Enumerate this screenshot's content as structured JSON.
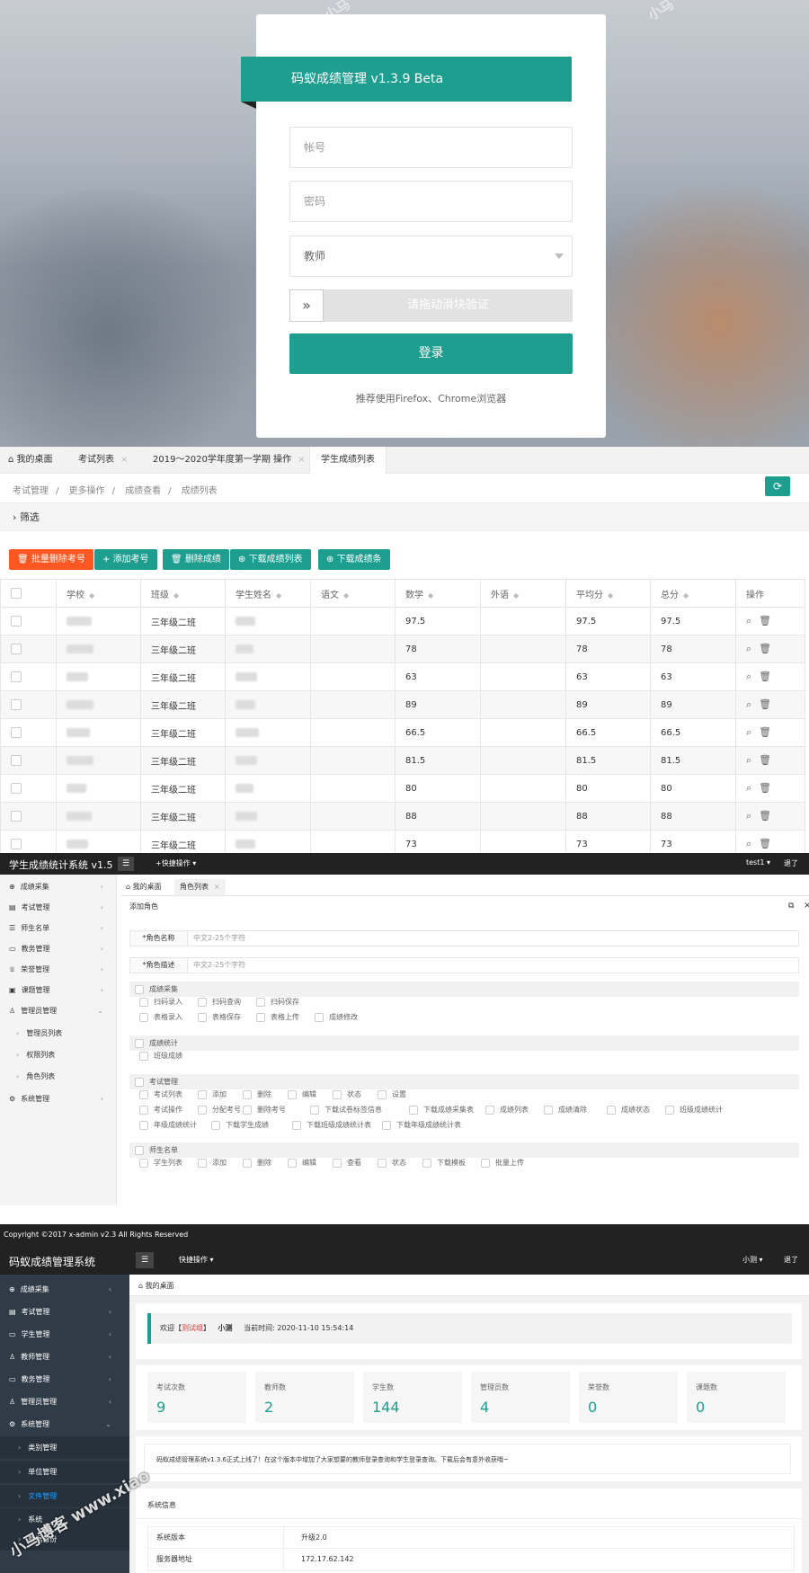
{
  "login": {
    "title": "码蚁成绩管理 v1.3.9 Beta",
    "account_placeholder": "帐号",
    "password_placeholder": "密码",
    "role_selected": "教师",
    "slider_text": "请拖动滑块验证",
    "submit_label": "登录",
    "hint": "推荐使用Firefox、Chrome浏览器",
    "brand_color": "#1e9e8f"
  },
  "score_list": {
    "tabs": [
      "我的桌面",
      "考试列表",
      "2019～2020学年度第一学期 操作",
      "学生成绩列表"
    ],
    "breadcrumb": [
      "考试管理",
      "更多操作",
      "成绩查看",
      "成绩列表"
    ],
    "filter_label": "筛选",
    "buttons": {
      "batch_delete": "批量删除考号",
      "add_exam_no": "添加考号",
      "delete_score": "删除成绩",
      "download_list": "下载成绩列表",
      "download_slip": "下载成绩条"
    },
    "columns": [
      "学校",
      "班级",
      "学生姓名",
      "语文",
      "数学",
      "外语",
      "平均分",
      "总分",
      "操作"
    ],
    "rows": [
      {
        "class": "三年级二班",
        "math": "97.5",
        "avg": "97.5",
        "total": "97.5"
      },
      {
        "class": "三年级二班",
        "math": "78",
        "avg": "78",
        "total": "78"
      },
      {
        "class": "三年级二班",
        "math": "63",
        "avg": "63",
        "total": "63"
      },
      {
        "class": "三年级二班",
        "math": "89",
        "avg": "89",
        "total": "89"
      },
      {
        "class": "三年级二班",
        "math": "66.5",
        "avg": "66.5",
        "total": "66.5"
      },
      {
        "class": "三年级二班",
        "math": "81.5",
        "avg": "81.5",
        "total": "81.5"
      },
      {
        "class": "三年级二班",
        "math": "80",
        "avg": "80",
        "total": "80"
      },
      {
        "class": "三年级二班",
        "math": "88",
        "avg": "88",
        "total": "88"
      },
      {
        "class": "三年级二班",
        "math": "73",
        "avg": "73",
        "total": "73"
      }
    ]
  },
  "role_admin": {
    "app_title": "学生成绩统计系统 v1.5",
    "quick_ops": "+快捷操作",
    "user": "test1",
    "logout": "退了",
    "sidebar": [
      "成绩采集",
      "考试管理",
      "师生名单",
      "教务管理",
      "荣誉管理",
      "课题管理",
      "管理员管理",
      "管理员列表",
      "权限列表",
      "角色列表",
      "系统管理"
    ],
    "tabs": [
      "我的桌面",
      "角色列表"
    ],
    "page_heading": "添加角色",
    "role_name_label": "*角色名称",
    "role_name_placeholder": "中文2-25个字符",
    "role_desc_label": "*角色描述",
    "role_desc_placeholder": "中文2-25个字符",
    "groups": [
      {
        "name": "成绩采集",
        "perms": [
          [
            "扫码录入",
            "扫码查询",
            "扫码保存"
          ],
          [
            "表格录入",
            "表格保存",
            "表格上传",
            "成绩修改"
          ]
        ]
      },
      {
        "name": "成绩统计",
        "perms": [
          [
            "班级成绩"
          ]
        ]
      },
      {
        "name": "考试管理",
        "perms": [
          [
            "考试列表",
            "添加",
            "删除",
            "编辑",
            "状态",
            "设置"
          ],
          [
            "考试操作",
            "分配考号",
            "删除考号",
            "下载试卷标签信息",
            "下载成绩采集表",
            "成绩列表",
            "成绩清除",
            "成绩状态",
            "班级成绩统计"
          ],
          [
            "年级成绩统计",
            "下载学生成绩",
            "下载班级成绩统计表",
            "下载年级成绩统计表"
          ]
        ]
      },
      {
        "name": "师生名单",
        "perms": [
          [
            "学生列表",
            "添加",
            "删除",
            "编辑",
            "查看",
            "状态",
            "下载模板",
            "批量上传"
          ]
        ]
      }
    ],
    "footer": "Copyright ©2017 x-admin v2.3 All Rights Reserved"
  },
  "dashboard": {
    "app_title": "码蚁成绩管理系统",
    "quick_ops": "快捷操作",
    "user": "小测",
    "logout": "退了",
    "sidebar": [
      "成绩采集",
      "考试管理",
      "学生管理",
      "教师管理",
      "教务管理",
      "管理员管理",
      "系统管理",
      "类别管理",
      "单位管理",
      "文件管理",
      "系统",
      "数据备份"
    ],
    "tab": "我的桌面",
    "welcome": {
      "prefix": "欢迎【",
      "role": "测试组",
      "suffix": "】",
      "name": "小测",
      "time_label": "当前时间:",
      "time": "2020-11-10 15:54:14"
    },
    "stats": [
      {
        "label": "考试次数",
        "value": "9"
      },
      {
        "label": "教师数",
        "value": "2"
      },
      {
        "label": "学生数",
        "value": "144"
      },
      {
        "label": "管理员数",
        "value": "4"
      },
      {
        "label": "荣誉数",
        "value": "0"
      },
      {
        "label": "课题数",
        "value": "0"
      }
    ],
    "notice": "码蚁成绩管理系统v1.3.6正式上线了！在这个版本中增加了大家想要的教师登录查询和学生登录查询。下载后会有意外收获哦~",
    "sysinfo_title": "系统信息",
    "sysinfo": [
      {
        "key": "系统版本",
        "value": "升级2.0"
      },
      {
        "key": "服务器地址",
        "value": "172.17.62.142"
      }
    ]
  },
  "watermark": "小马博客 www.xiao"
}
